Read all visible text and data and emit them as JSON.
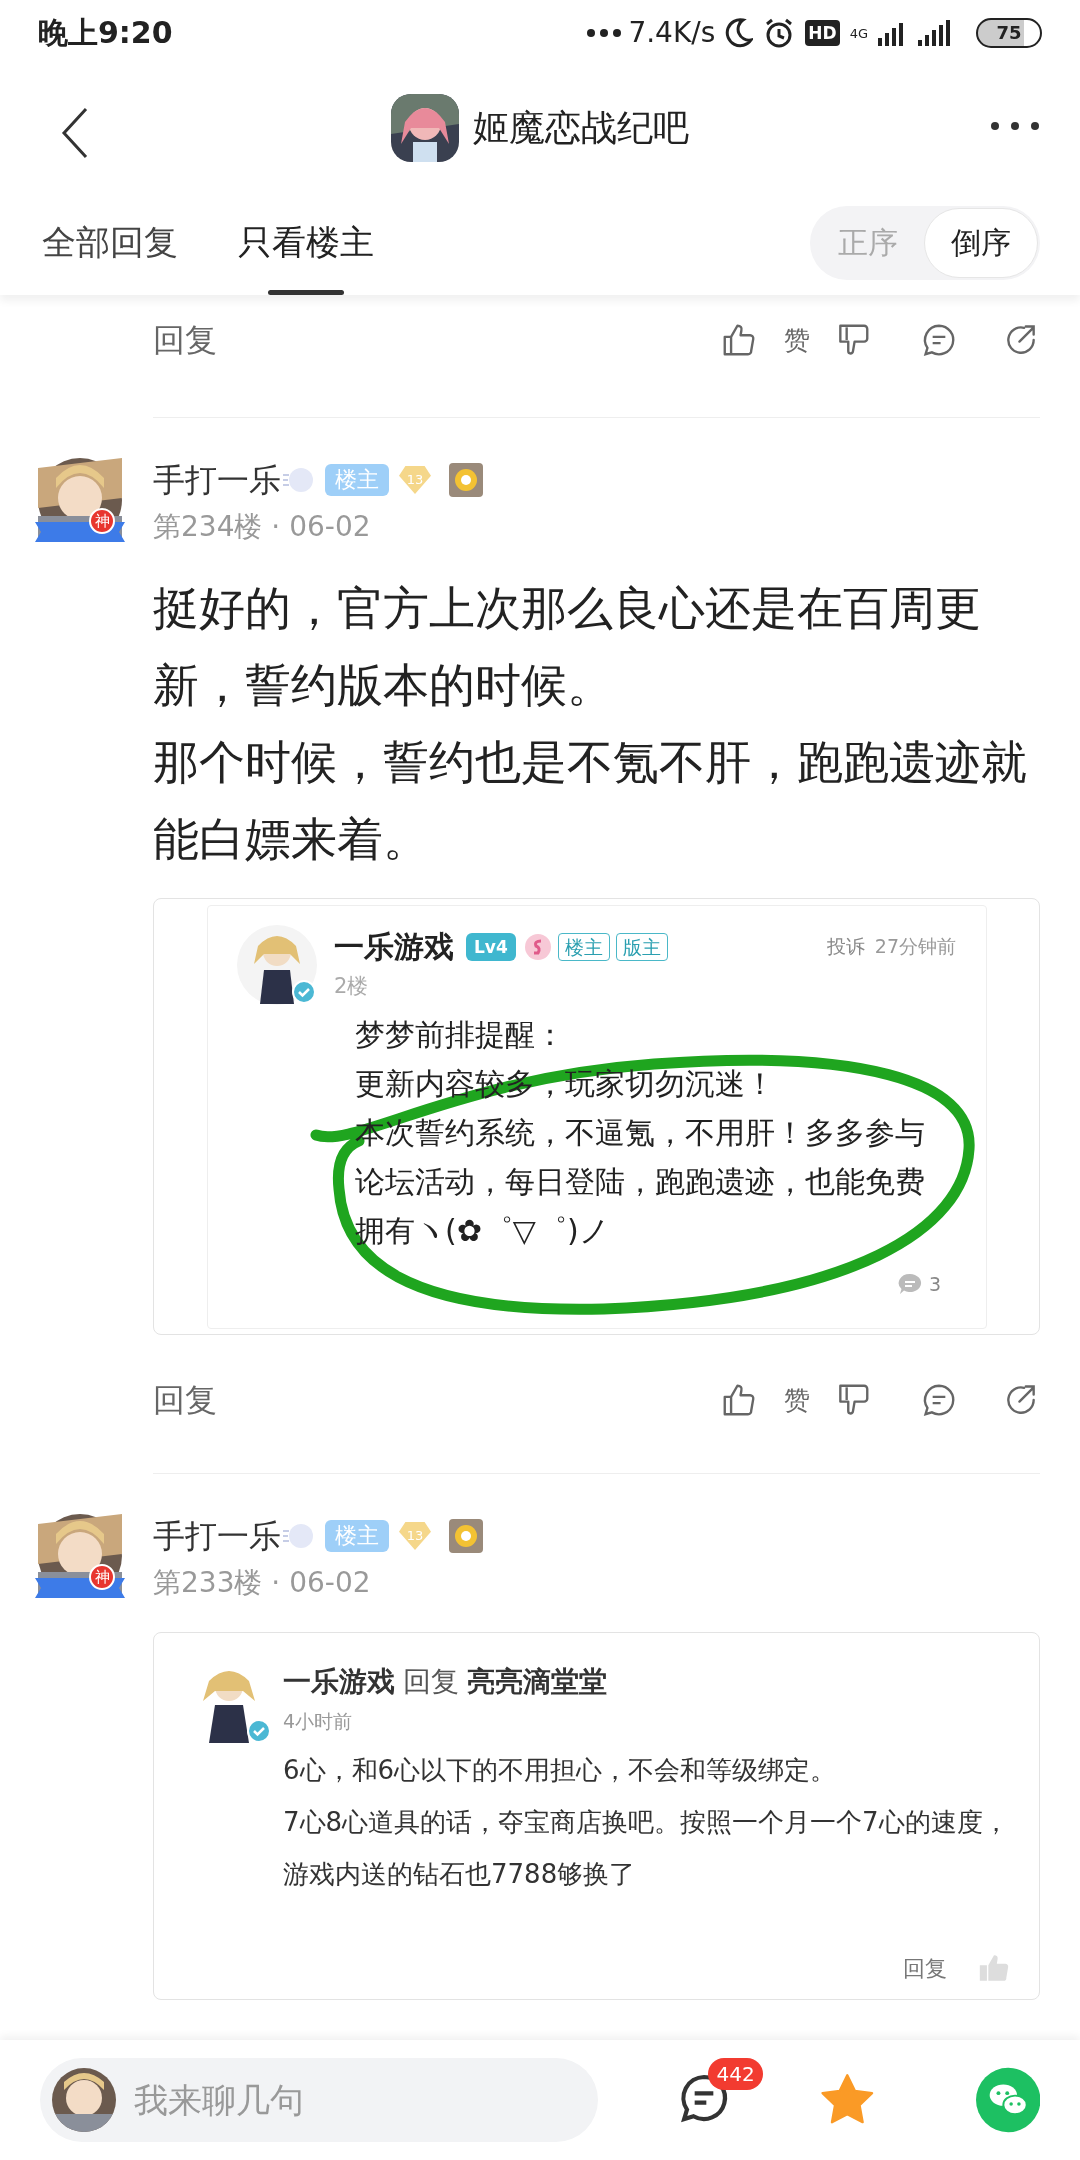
{
  "status_bar": {
    "time": "晚上9:20",
    "net_speed": "7.4K/s",
    "hd": "HD",
    "network": "4G",
    "battery": "75"
  },
  "nav": {
    "title": "姬魔恋战纪吧"
  },
  "tabs": [
    {
      "label": "全部回复",
      "selected": false
    },
    {
      "label": "只看楼主",
      "selected": true
    }
  ],
  "sort": [
    {
      "label": "正序",
      "selected": false
    },
    {
      "label": "倒序",
      "selected": true
    }
  ],
  "top_actions": {
    "reply": "回复",
    "like": "赞"
  },
  "posts": [
    {
      "author": "手打一乐",
      "avatar_badge": "神",
      "role": "楼主",
      "level": "13",
      "floor": "第234楼 · 06-02",
      "body": [
        "挺好的，官方上次那么良心还是在百周更新，誓约版本的时候。",
        "那个时候，誓约也是不氪不肝，跑跑遗迹就能白嫖来着。"
      ],
      "quote": {
        "kind": "post",
        "author": "一乐游戏",
        "level": "Lv4",
        "tags": [
          "楼主",
          "版主"
        ],
        "report": "投诉",
        "time": "27分钟前",
        "floor": "2楼",
        "lines": [
          "梦梦前排提醒：",
          "更新内容较多，玩家切勿沉迷！",
          "本次誓约系统，不逼氪，不用肝！多多参与论坛活动，每日登陆，跑跑遗迹，也能免费拥有ヽ(✿゜▽゜)ノ"
        ],
        "comments": "3"
      },
      "actions": {
        "reply": "回复",
        "like": "赞"
      }
    },
    {
      "author": "手打一乐",
      "avatar_badge": "神",
      "role": "楼主",
      "level": "13",
      "floor": "第233楼 · 06-02",
      "quote": {
        "kind": "reply",
        "author": "一乐游戏",
        "reply_word": "回复",
        "target": "亮亮滴堂堂",
        "time": "4小时前",
        "lines": [
          "6心，和6心以下的不用担心，不会和等级绑定。",
          "7心8心道具的话，夺宝商店换吧。按照一个月一个7心的速度，游戏内送的钻石也7788够换了"
        ],
        "reply": "回复"
      }
    }
  ],
  "bottom_bar": {
    "placeholder": "我来聊几句",
    "comment_count": "442"
  }
}
